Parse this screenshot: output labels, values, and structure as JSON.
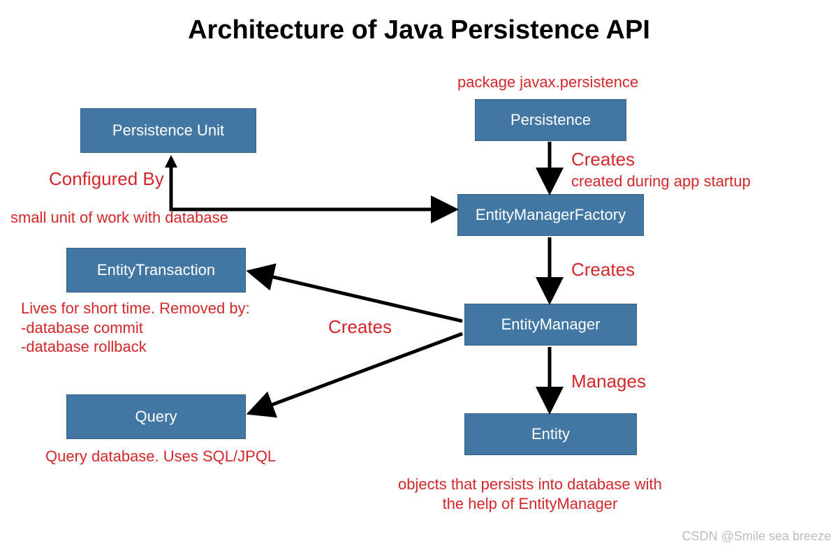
{
  "title": "Architecture of Java Persistence API",
  "boxes": {
    "persistenceUnit": "Persistence Unit",
    "entityTransaction": "EntityTransaction",
    "query": "Query",
    "persistence": "Persistence",
    "entityManagerFactory": "EntityManagerFactory",
    "entityManager": "EntityManager",
    "entity": "Entity"
  },
  "annotations": {
    "packageLabel": "package javax.persistence",
    "configuredBy": "Configured By",
    "smallUnit": "small unit of work with database",
    "creates1": "Creates",
    "createdDuring": "created during app startup",
    "creates2": "Creates",
    "creates3": "Creates",
    "livesShort": "Lives for short time. Removed by:\n-database commit\n-database rollback",
    "manages": "Manages",
    "queryDesc": "Query database. Uses SQL/JPQL",
    "entityDesc": "objects that persists into database with\nthe help of EntityManager"
  },
  "watermark": "CSDN @Smile sea breeze"
}
